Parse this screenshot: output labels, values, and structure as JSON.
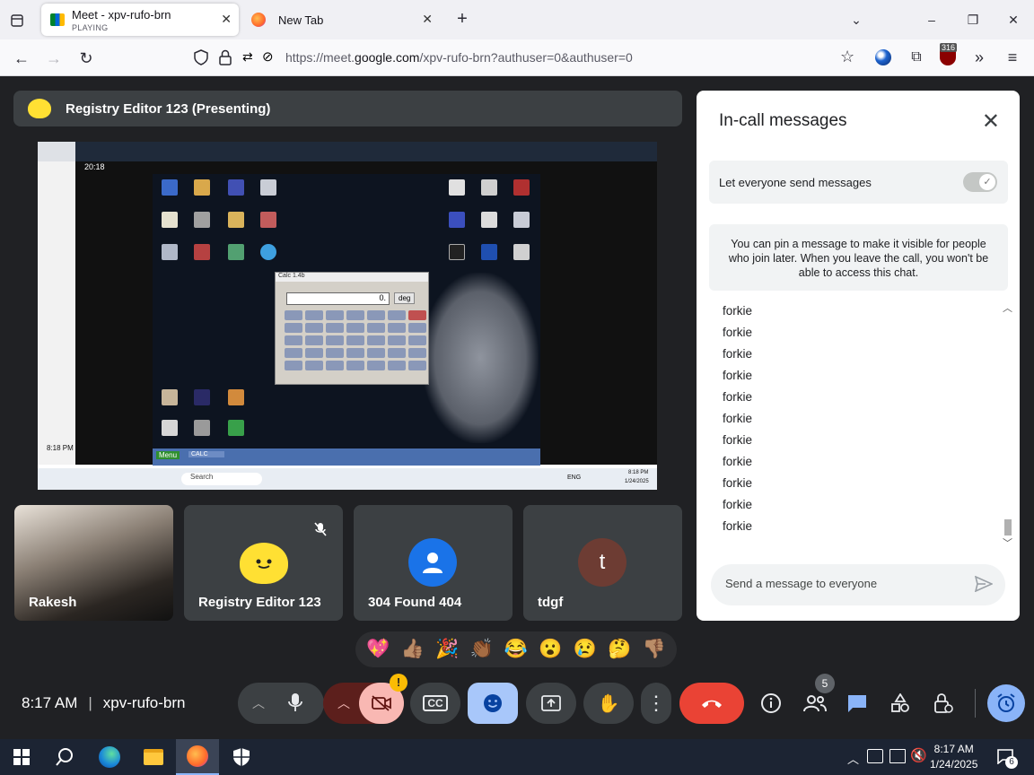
{
  "browser": {
    "tabs": [
      {
        "title": "Meet - xpv-rufo-brn",
        "subtitle": "PLAYING"
      },
      {
        "title": "New Tab"
      }
    ],
    "url_prefix": "https://meet.",
    "url_domain": "google.com",
    "url_path": "/xpv-rufo-brn?authuser=0&authuser=0",
    "extension_badge": "316"
  },
  "meet": {
    "presenter_label": "Registry Editor 123 (Presenting)",
    "shared_screen": {
      "time": "20:18",
      "side_time": "8:18 PM",
      "calc_title": "Calc 1.4b",
      "calc_display": "0.",
      "calc_deg": "deg",
      "menu_label": "Menu",
      "task_calc": "CALC",
      "clock_time": "8:18 PM",
      "clock_date": "1/24/2025",
      "search_label": "Search",
      "lang": "ENG"
    },
    "participants": [
      {
        "name": "Rakesh"
      },
      {
        "name": "Registry Editor 123"
      },
      {
        "name": "304 Found 404"
      },
      {
        "name": "tdgf",
        "initial": "t"
      }
    ],
    "reactions": [
      "💖",
      "👍🏽",
      "🎉",
      "👏🏾",
      "😂",
      "😮",
      "😢",
      "🤔",
      "👎🏽"
    ],
    "time": "8:17 AM",
    "meeting_code": "xpv-rufo-brn",
    "people_count": "5",
    "camera_alert": "!"
  },
  "chat": {
    "title": "In-call messages",
    "toggle_label": "Let everyone send messages",
    "pin_note": "You can pin a message to make it visible for people who join later. When you leave the call, you won't be able to access this chat.",
    "messages": [
      "forkie",
      "forkie",
      "forkie",
      "forkie",
      "forkie",
      "forkie",
      "forkie",
      "forkie",
      "forkie",
      "forkie",
      "forkie"
    ],
    "input_placeholder": "Send a message to everyone"
  },
  "taskbar": {
    "time": "8:17 AM",
    "date": "1/24/2025",
    "notification_count": "6"
  },
  "colors": {
    "meet_bg": "#202124",
    "tile_bg": "#3c4043",
    "end_call": "#ea4335",
    "accent_blue": "#8ab4f8",
    "camera_off": "#f9b8b3"
  }
}
